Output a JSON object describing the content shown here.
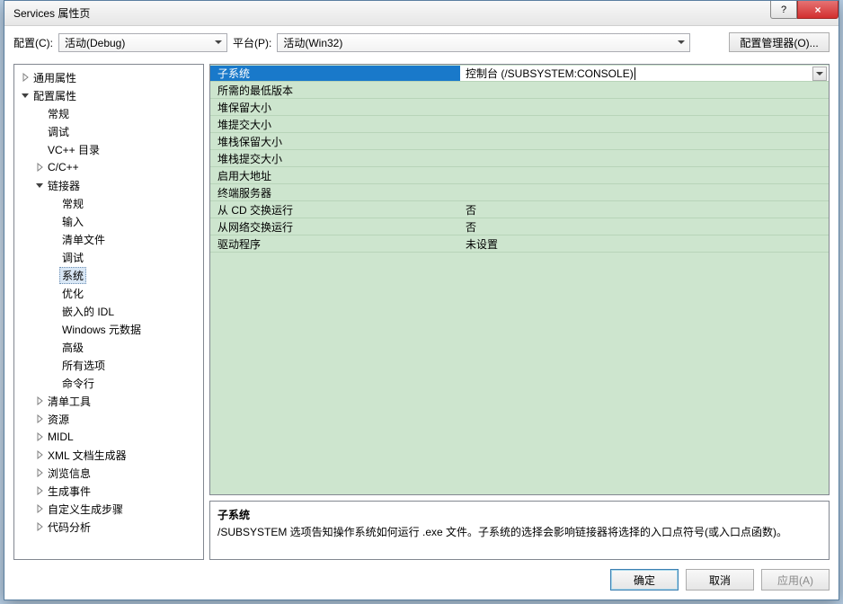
{
  "window": {
    "title": "Services 属性页"
  },
  "titlebar_buttons": {
    "help": "?",
    "close": "×"
  },
  "toolbar": {
    "config_label": "配置(C):",
    "config_value": "活动(Debug)",
    "platform_label": "平台(P):",
    "platform_value": "活动(Win32)",
    "manager_label": "配置管理器(O)..."
  },
  "tree": [
    {
      "level": 0,
      "label": "通用属性",
      "arrow": "closed"
    },
    {
      "level": 0,
      "label": "配置属性",
      "arrow": "open"
    },
    {
      "level": 1,
      "label": "常规",
      "arrow": "none"
    },
    {
      "level": 1,
      "label": "调试",
      "arrow": "none"
    },
    {
      "level": 1,
      "label": "VC++ 目录",
      "arrow": "none"
    },
    {
      "level": 1,
      "label": "C/C++",
      "arrow": "closed"
    },
    {
      "level": 1,
      "label": "链接器",
      "arrow": "open"
    },
    {
      "level": 2,
      "label": "常规",
      "arrow": "none"
    },
    {
      "level": 2,
      "label": "输入",
      "arrow": "none"
    },
    {
      "level": 2,
      "label": "清单文件",
      "arrow": "none"
    },
    {
      "level": 2,
      "label": "调试",
      "arrow": "none"
    },
    {
      "level": 2,
      "label": "系统",
      "arrow": "none",
      "selected": true
    },
    {
      "level": 2,
      "label": "优化",
      "arrow": "none"
    },
    {
      "level": 2,
      "label": "嵌入的 IDL",
      "arrow": "none"
    },
    {
      "level": 2,
      "label": "Windows 元数据",
      "arrow": "none"
    },
    {
      "level": 2,
      "label": "高级",
      "arrow": "none"
    },
    {
      "level": 2,
      "label": "所有选项",
      "arrow": "none"
    },
    {
      "level": 2,
      "label": "命令行",
      "arrow": "none"
    },
    {
      "level": 1,
      "label": "清单工具",
      "arrow": "closed"
    },
    {
      "level": 1,
      "label": "资源",
      "arrow": "closed"
    },
    {
      "level": 1,
      "label": "MIDL",
      "arrow": "closed"
    },
    {
      "level": 1,
      "label": "XML 文档生成器",
      "arrow": "closed"
    },
    {
      "level": 1,
      "label": "浏览信息",
      "arrow": "closed"
    },
    {
      "level": 1,
      "label": "生成事件",
      "arrow": "closed"
    },
    {
      "level": 1,
      "label": "自定义生成步骤",
      "arrow": "closed"
    },
    {
      "level": 1,
      "label": "代码分析",
      "arrow": "closed"
    }
  ],
  "grid": [
    {
      "name": "子系统",
      "value": "控制台 (/SUBSYSTEM:CONSOLE)",
      "selected": true
    },
    {
      "name": "所需的最低版本",
      "value": ""
    },
    {
      "name": "堆保留大小",
      "value": ""
    },
    {
      "name": "堆提交大小",
      "value": ""
    },
    {
      "name": "堆栈保留大小",
      "value": ""
    },
    {
      "name": "堆栈提交大小",
      "value": ""
    },
    {
      "name": "启用大地址",
      "value": ""
    },
    {
      "name": "终端服务器",
      "value": ""
    },
    {
      "name": "从 CD 交换运行",
      "value": "否"
    },
    {
      "name": "从网络交换运行",
      "value": "否"
    },
    {
      "name": "驱动程序",
      "value": "未设置"
    }
  ],
  "description": {
    "title": "子系统",
    "text": "/SUBSYSTEM 选项告知操作系统如何运行 .exe 文件。子系统的选择会影响链接器将选择的入口点符号(或入口点函数)。"
  },
  "buttons": {
    "ok": "确定",
    "cancel": "取消",
    "apply": "应用(A)"
  }
}
